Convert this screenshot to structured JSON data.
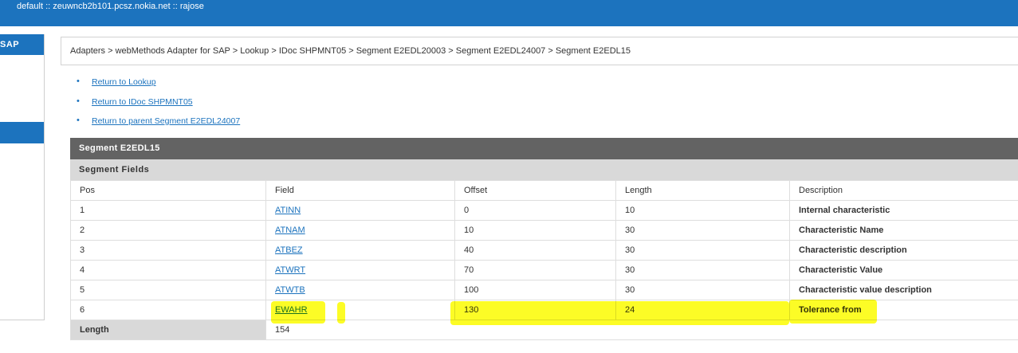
{
  "header": {
    "context": "default :: zeuwncb2b101.pcsz.nokia.net :: rajose"
  },
  "sidebar": {
    "heading": "SAP"
  },
  "breadcrumb": "Adapters > webMethods Adapter for SAP > Lookup > IDoc SHPMNT05 > Segment E2EDL20003 > Segment E2EDL24007 > Segment E2EDL15",
  "links": [
    "Return to Lookup",
    "Return to IDoc SHPMNT05",
    "Return to parent Segment E2EDL24007"
  ],
  "segment": {
    "title": "Segment E2EDL15",
    "subtitle": "Segment Fields",
    "columns": [
      "Pos",
      "Field",
      "Offset",
      "Length",
      "Description"
    ],
    "rows": [
      {
        "pos": "1",
        "field": "ATINN",
        "offset": "0",
        "length": "10",
        "description": "Internal characteristic"
      },
      {
        "pos": "2",
        "field": "ATNAM",
        "offset": "10",
        "length": "30",
        "description": "Characteristic Name"
      },
      {
        "pos": "3",
        "field": "ATBEZ",
        "offset": "40",
        "length": "30",
        "description": "Characteristic description"
      },
      {
        "pos": "4",
        "field": "ATWRT",
        "offset": "70",
        "length": "30",
        "description": "Characteristic Value"
      },
      {
        "pos": "5",
        "field": "ATWTB",
        "offset": "100",
        "length": "30",
        "description": "Characteristic value description"
      },
      {
        "pos": "6",
        "field": "EWAHR",
        "offset": "130",
        "length": "24",
        "description": "Tolerance from"
      }
    ],
    "length_label": "Length",
    "length_value": "154"
  },
  "colors": {
    "accent": "#1c73be",
    "panel_header": "#636363",
    "highlight": "#fbfb00"
  }
}
